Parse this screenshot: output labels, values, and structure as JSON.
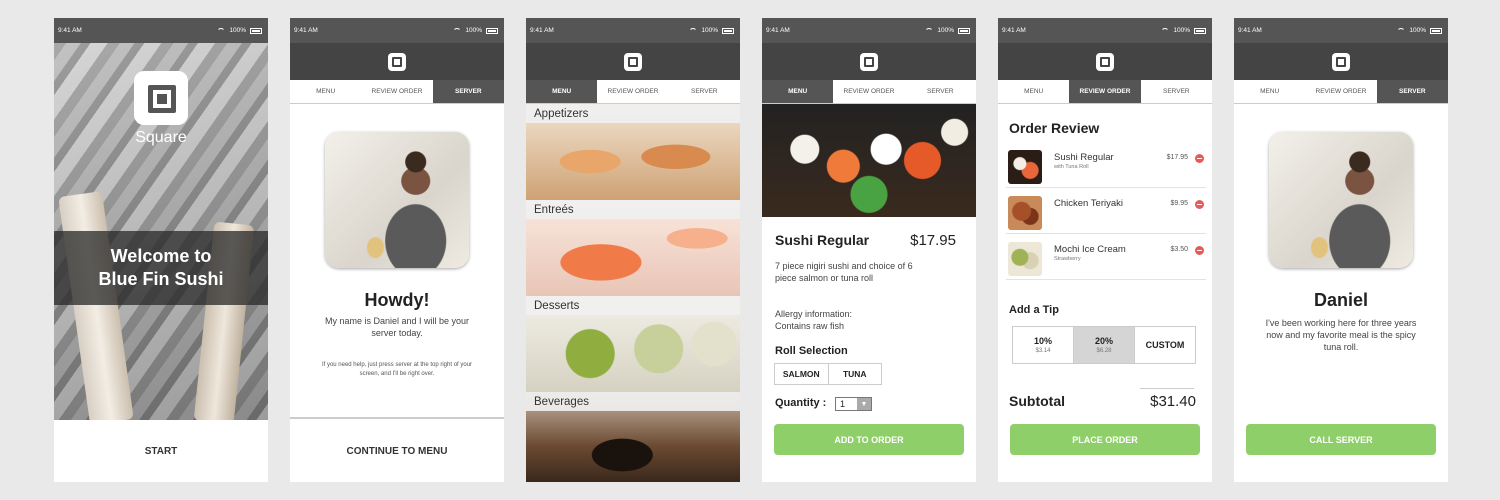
{
  "status": {
    "time": "9:41 AM",
    "battery": "100%"
  },
  "tabs": {
    "menu": "MENU",
    "review": "REVIEW ORDER",
    "server": "SERVER"
  },
  "screen1": {
    "brand": "Square",
    "welcome_line1": "Welcome to",
    "welcome_line2": "Blue Fin Sushi",
    "start": "START"
  },
  "screen2": {
    "title": "Howdy!",
    "text": "My name is Daniel and I will be your server today.",
    "help": "If you need help, just press server at the top right of your screen, and I'll be right over.",
    "continue": "CONTINUE TO MENU"
  },
  "screen3": {
    "categories": [
      "Appetizers",
      "Entreés",
      "Desserts",
      "Beverages"
    ]
  },
  "screen4": {
    "name": "Sushi Regular",
    "price": "$17.95",
    "description": "7 piece nigiri sushi and choice of 6 piece salmon or tuna roll",
    "allergy_line1": "Allergy information:",
    "allergy_line2": "Contains raw fish",
    "roll_title": "Roll Selection",
    "roll_options": [
      "SALMON",
      "TUNA"
    ],
    "quantity_label": "Quantity :",
    "quantity_value": "1",
    "add_button": "ADD TO ORDER"
  },
  "screen5": {
    "title": "Order Review",
    "items": [
      {
        "name": "Sushi Regular",
        "sub": "with Tuna Roll",
        "price": "$17.95"
      },
      {
        "name": "Chicken Teriyaki",
        "sub": "",
        "price": "$9.95"
      },
      {
        "name": "Mochi Ice Cream",
        "sub": "Strawberry",
        "price": "$3.50"
      }
    ],
    "tip_title": "Add a Tip",
    "tips": [
      {
        "label": "10%",
        "amount": "$3.14"
      },
      {
        "label": "20%",
        "amount": "$6.28"
      },
      {
        "label": "CUSTOM",
        "amount": ""
      }
    ],
    "subtotal_label": "Subtotal",
    "subtotal_value": "$31.40",
    "place_button": "PLACE ORDER"
  },
  "screen6": {
    "name": "Daniel",
    "text": "I've been working here for three years now and my favorite meal is the spicy tuna roll.",
    "call_button": "CALL SERVER"
  },
  "colors": {
    "accent_green": "#8fcf6a",
    "bar_dark": "#444444",
    "tab_active": "#555555",
    "remove_red": "#e35b5b"
  }
}
